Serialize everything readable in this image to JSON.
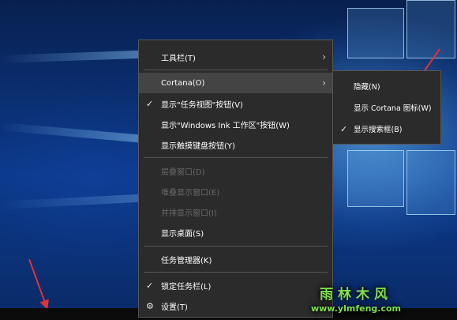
{
  "context_menu": {
    "items": [
      {
        "label": "工具栏(T)",
        "submenu": true,
        "checked": false,
        "disabled": false
      },
      {
        "label": "Cortana(O)",
        "submenu": true,
        "checked": false,
        "disabled": false,
        "highlighted": true
      },
      {
        "label": "显示\"任务视图\"按钮(V)",
        "submenu": false,
        "checked": true,
        "disabled": false
      },
      {
        "label": "显示\"Windows Ink 工作区\"按钮(W)",
        "submenu": false,
        "checked": false,
        "disabled": false
      },
      {
        "label": "显示触摸键盘按钮(Y)",
        "submenu": false,
        "checked": false,
        "disabled": false
      },
      {
        "label": "层叠窗口(D)",
        "submenu": false,
        "checked": false,
        "disabled": true
      },
      {
        "label": "堆叠显示窗口(E)",
        "submenu": false,
        "checked": false,
        "disabled": true
      },
      {
        "label": "并排显示窗口(I)",
        "submenu": false,
        "checked": false,
        "disabled": true
      },
      {
        "label": "显示桌面(S)",
        "submenu": false,
        "checked": false,
        "disabled": false
      },
      {
        "label": "任务管理器(K)",
        "submenu": false,
        "checked": false,
        "disabled": false
      },
      {
        "label": "锁定任务栏(L)",
        "submenu": false,
        "checked": true,
        "disabled": false
      },
      {
        "label": "设置(T)",
        "submenu": false,
        "checked": false,
        "disabled": false,
        "icon": "gear-icon"
      }
    ]
  },
  "cortana_submenu": {
    "items": [
      {
        "label": "隐藏(N)",
        "checked": false
      },
      {
        "label": "显示 Cortana 图标(W)",
        "checked": false
      },
      {
        "label": "显示搜索框(B)",
        "checked": true
      }
    ]
  },
  "glyphs": {
    "check": "✓",
    "chevron": "›",
    "gear": "⚙"
  },
  "watermark": {
    "title": "雨林木风",
    "url": "www.ylmfeng.com"
  },
  "colors": {
    "menu_bg": "#2b2b2b",
    "highlight": "#444444",
    "arrow": "#e23232",
    "watermark": "#7fe04a"
  }
}
